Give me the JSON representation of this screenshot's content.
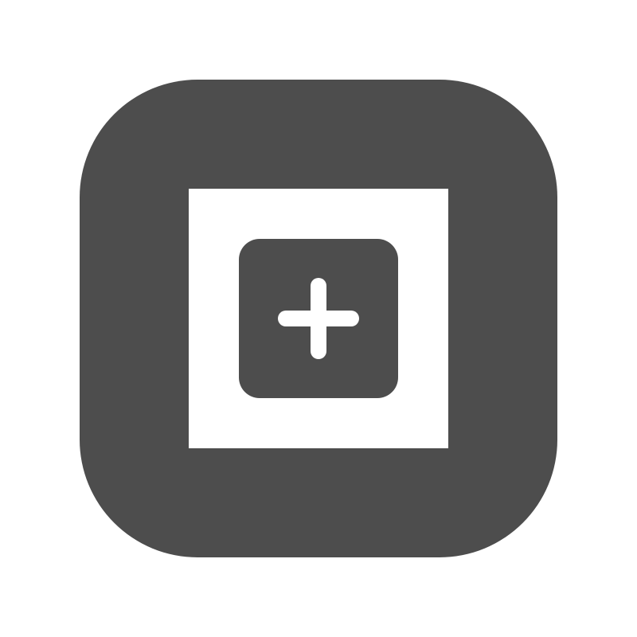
{
  "icon": {
    "name": "add-icon",
    "glyph": "plus-icon"
  },
  "colors": {
    "background": "#ffffff",
    "tile": "#4d4d4d",
    "frame": "#ffffff",
    "plus": "#ffffff"
  }
}
